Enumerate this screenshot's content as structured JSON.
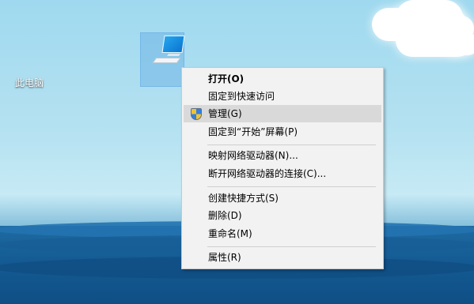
{
  "desktop": {
    "icon_label": "此电脑"
  },
  "context_menu": {
    "items": [
      {
        "label": "打开(O)",
        "bold": true
      },
      {
        "label": "固定到快速访问"
      },
      {
        "label": "管理(G)",
        "icon": "shield-icon",
        "highlight": true
      },
      {
        "label": "固定到“开始”屏幕(P)"
      },
      {
        "label": "映射网络驱动器(N)..."
      },
      {
        "label": "断开网络驱动器的连接(C)..."
      },
      {
        "label": "创建快捷方式(S)"
      },
      {
        "label": "删除(D)"
      },
      {
        "label": "重命名(M)"
      },
      {
        "label": "属性(R)"
      }
    ]
  },
  "colors": {
    "menu_background": "#f2f2f2",
    "menu_highlight": "#d9d9d9",
    "icon_selection": "#4797dc"
  }
}
